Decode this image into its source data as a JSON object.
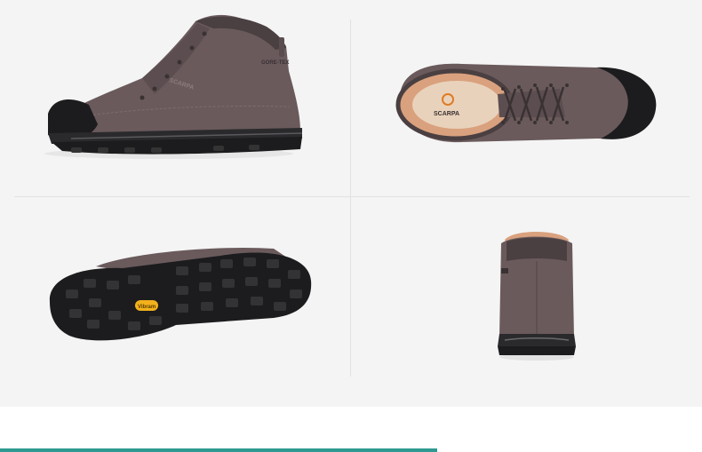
{
  "photos": [
    {
      "view": "side",
      "logo_text": "SCARPA",
      "badge_text": "GORE-TEX"
    },
    {
      "view": "top",
      "logo_text": "SCARPA"
    },
    {
      "view": "sole",
      "badge_text": "Vibram"
    },
    {
      "view": "back"
    }
  ],
  "colors": {
    "background": "#f4f4f4",
    "suede": "#6a5a5c",
    "suede_dark": "#4a3f41",
    "rubber": "#1c1c1e",
    "lining": "#d9a17e",
    "vibram_badge": "#f2b21c",
    "accent_bar": "#2e9a91"
  }
}
